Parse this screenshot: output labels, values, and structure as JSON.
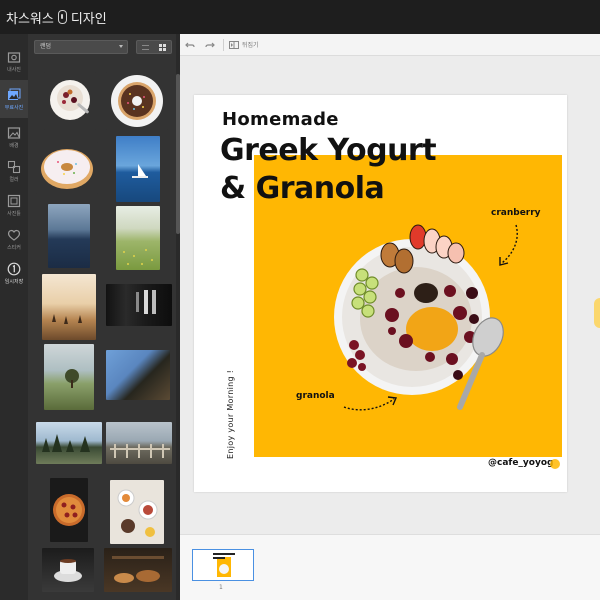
{
  "app": {
    "title_left": "차스워스",
    "title_right": "디자인"
  },
  "rail": {
    "items": [
      {
        "label": "내사진",
        "icon": "upload-icon",
        "active": false
      },
      {
        "label": "무료사진",
        "icon": "photo-stack-icon",
        "active": true
      },
      {
        "label": "배경",
        "icon": "image-icon",
        "active": false
      },
      {
        "label": "컬러",
        "icon": "palette-icon",
        "active": false
      },
      {
        "label": "사진틀",
        "icon": "frame-icon",
        "active": false
      },
      {
        "label": "스티커",
        "icon": "heart-icon",
        "active": false
      },
      {
        "label": "임시저장",
        "icon": "one-icon",
        "active": false
      }
    ]
  },
  "panel": {
    "sort_label": "랜덤"
  },
  "toolbar": {
    "flip_label": "뒤집기"
  },
  "design": {
    "subtitle": "Homemade",
    "title_line1": "Greek Yogurt",
    "title_line2": "& Granola",
    "label_cranberry": "cranberry",
    "label_granola": "granola",
    "side_text": "Enjoy your Morning !",
    "handle": "@cafe_yoyog",
    "accent_color": "#ffb703"
  },
  "pages": {
    "current_page": "1"
  }
}
